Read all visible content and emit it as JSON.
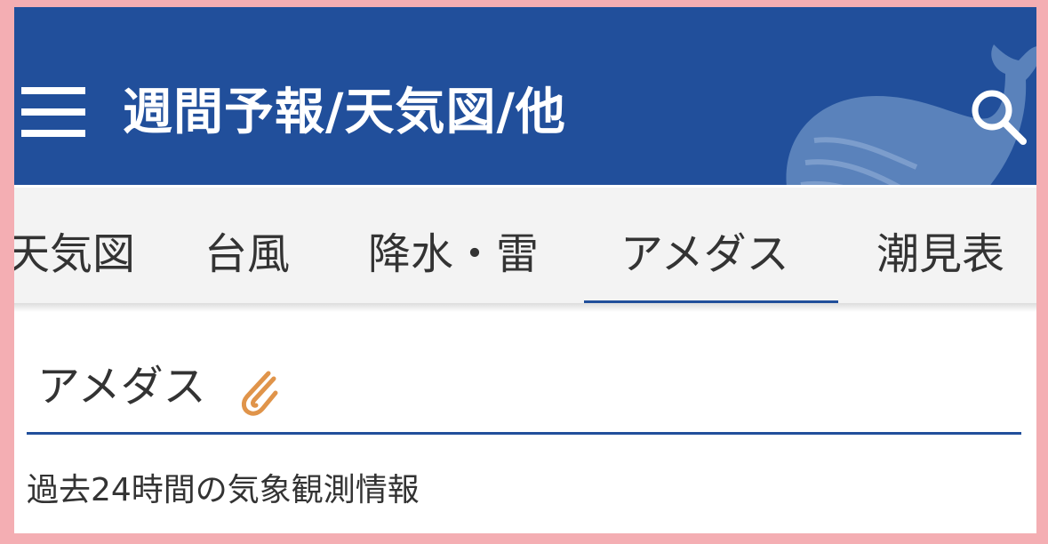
{
  "header": {
    "title": "週間予報/天気図/他",
    "menu_icon": "hamburger-menu-icon",
    "search_icon": "search-icon",
    "decoration": "whale-illustration",
    "background_color": "#214f9b"
  },
  "tabs": {
    "items": [
      {
        "label": "天気図",
        "active": false
      },
      {
        "label": "台風",
        "active": false
      },
      {
        "label": "降水・雷",
        "active": false
      },
      {
        "label": "アメダス",
        "active": true
      },
      {
        "label": "潮見表",
        "active": false
      }
    ],
    "indicator_color": "#214f9b"
  },
  "section": {
    "title": "アメダス",
    "title_icon": "paperclip-icon",
    "icon_color": "#e0944a",
    "description": "過去24時間の気象観測情報"
  }
}
